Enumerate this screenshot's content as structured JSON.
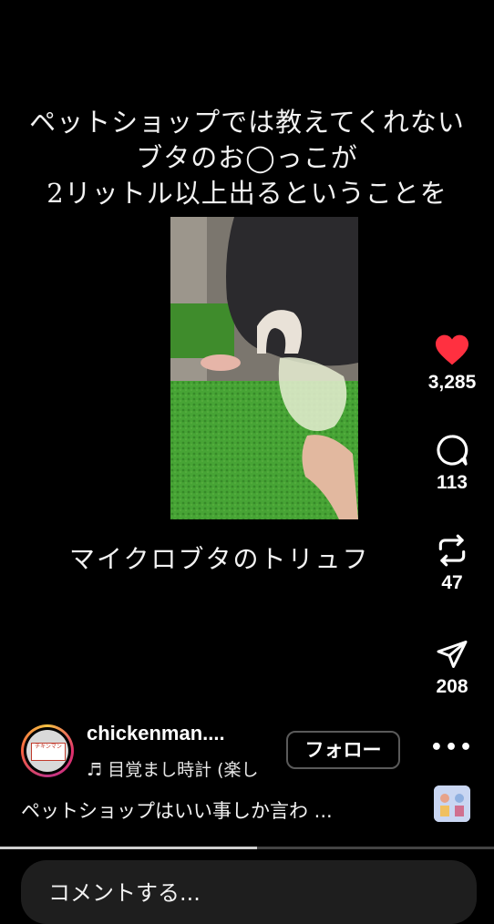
{
  "overlay": {
    "lines": [
      "ペットショップでは教えてくれない",
      "ブタのお◯っこが",
      "2リットル以上出るということを"
    ],
    "subtitle": "マイクロブタのトリュフ"
  },
  "actions": {
    "like_count": "3,285",
    "comment_count": "113",
    "repost_count": "47",
    "share_count": "208",
    "more": "•••",
    "like_color": "#ff3040"
  },
  "author": {
    "username": "chickenman....",
    "avatar_label": "チキンマン",
    "music": "♬ 目覚まし時計 (楽し",
    "follow_label": "フォロー"
  },
  "description": "ペットショップはいい事しか言わ ...",
  "comment_input": {
    "placeholder": "コメントする..."
  },
  "progress": 0.52
}
